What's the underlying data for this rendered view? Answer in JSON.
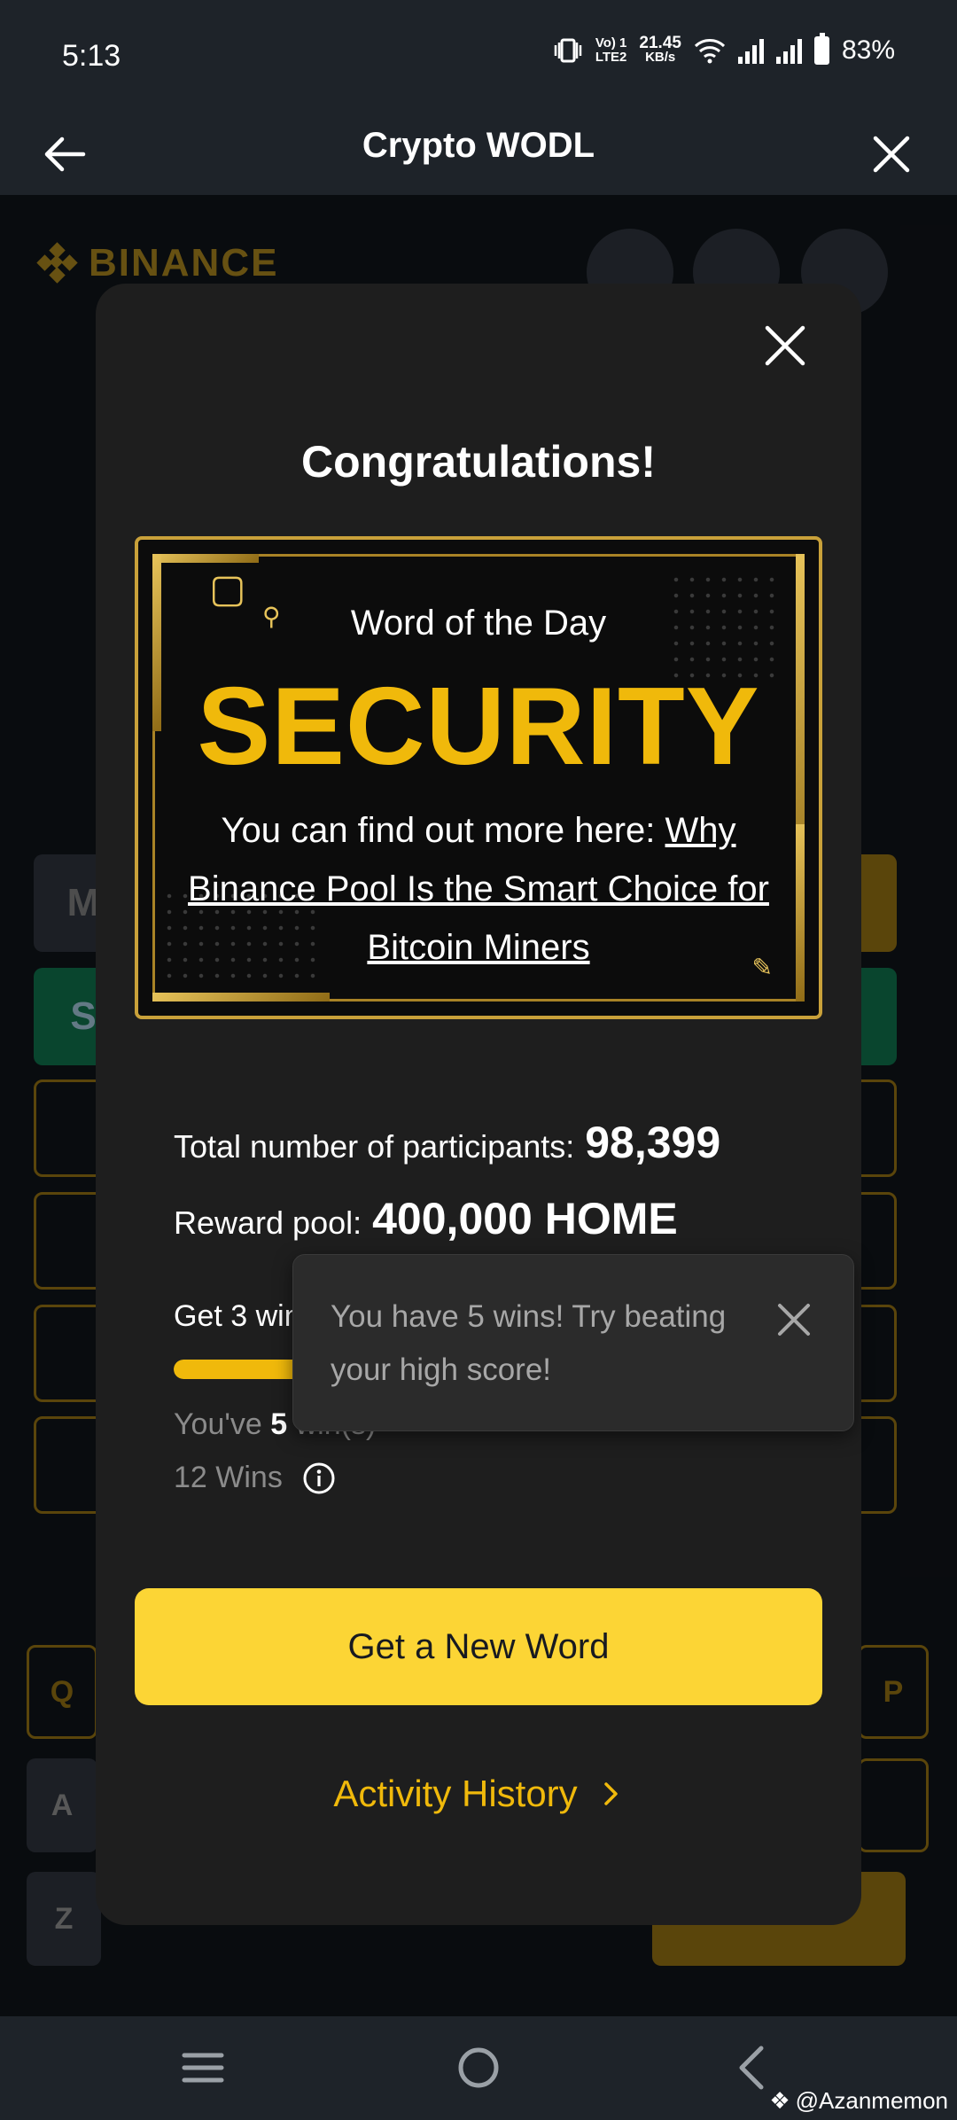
{
  "status_bar": {
    "time": "5:13",
    "net_label_top": "Vo) 1",
    "net_label_bottom": "LTE2",
    "speed_value": "21.45",
    "speed_unit": "KB/s",
    "battery": "83%"
  },
  "header": {
    "title": "Crypto WODL",
    "back_icon": "arrow-left-icon",
    "close_icon": "close-icon"
  },
  "background_game": {
    "logo_text": "BINANCE",
    "tiles": [
      "M",
      "S"
    ],
    "keys": [
      "Q",
      "A",
      "Z",
      "P"
    ]
  },
  "modal": {
    "title": "Congratulations!",
    "card": {
      "label": "Word of the Day",
      "word": "SECURITY",
      "more_prefix": "You can find out more here: ",
      "link_text": "Why Binance Pool Is the Smart Choice for Bitcoin Miners"
    },
    "stats": {
      "participants_label": "Total number of participants:",
      "participants_value": "98,399",
      "reward_label": "Reward pool:",
      "reward_value": "400,000 HOME"
    },
    "goal_label": "Get 3 wins",
    "progress_fraction": 1.0,
    "youve_prefix": "You've ",
    "youve_count": "5",
    "youve_suffix": " win(s)",
    "wins_label": "12 Wins",
    "primary_button": "Get a New Word",
    "activity_link": "Activity History"
  },
  "tooltip": {
    "text": "You have 5 wins! Try beating your high score!"
  },
  "watermark": "@Azanmemon",
  "colors": {
    "accent": "#f0b90b",
    "button": "#fcd535",
    "modal_bg": "#1e1e1e",
    "header_bg": "#1e2329"
  }
}
